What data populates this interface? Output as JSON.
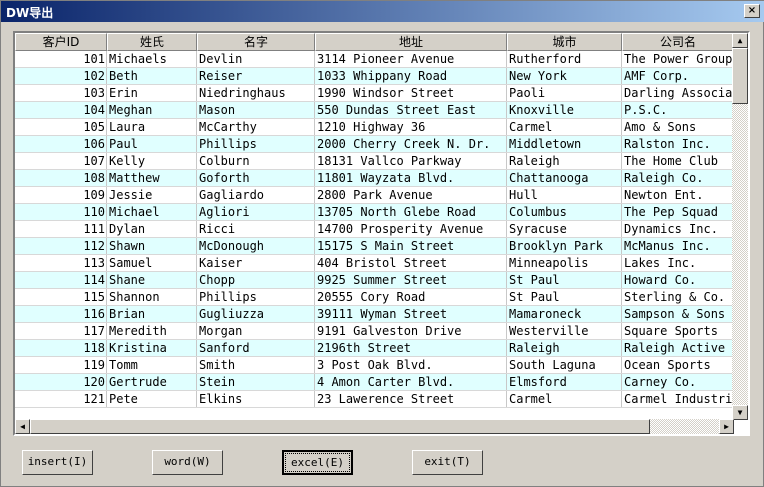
{
  "window": {
    "title": "DW导出",
    "close": "×"
  },
  "columns": [
    "客户ID",
    "姓氏",
    "名字",
    "地址",
    "城市",
    "公司名"
  ],
  "rows": [
    [
      "101",
      "Michaels",
      "Devlin",
      "3114 Pioneer Avenue",
      "Rutherford",
      "The Power Group"
    ],
    [
      "102",
      "Beth",
      "Reiser",
      "1033 Whippany Road",
      "New York",
      "AMF Corp."
    ],
    [
      "103",
      "Erin",
      "Niedringhaus",
      "1990 Windsor Street",
      "Paoli",
      "Darling Associates"
    ],
    [
      "104",
      "Meghan",
      "Mason",
      "550 Dundas Street East",
      "Knoxville",
      "P.S.C."
    ],
    [
      "105",
      "Laura",
      "McCarthy",
      "1210 Highway 36",
      "Carmel",
      "Amo & Sons"
    ],
    [
      "106",
      "Paul",
      "Phillips",
      "2000 Cherry Creek N. Dr.",
      "Middletown",
      "Ralston Inc."
    ],
    [
      "107",
      "Kelly",
      "Colburn",
      "18131 Vallco Parkway",
      "Raleigh",
      "The Home Club"
    ],
    [
      "108",
      "Matthew",
      "Goforth",
      "11801 Wayzata Blvd.",
      "Chattanooga",
      "Raleigh Co."
    ],
    [
      "109",
      "Jessie",
      "Gagliardo",
      "2800 Park Avenue",
      "Hull",
      "Newton Ent."
    ],
    [
      "110",
      "Michael",
      "Agliori",
      "13705 North Glebe Road",
      "Columbus",
      "The Pep Squad"
    ],
    [
      "111",
      "Dylan",
      "Ricci",
      "14700 Prosperity Avenue",
      "Syracuse",
      "Dynamics Inc."
    ],
    [
      "112",
      "Shawn",
      "McDonough",
      "15175 S Main Street",
      "Brooklyn Park",
      "McManus Inc."
    ],
    [
      "113",
      "Samuel",
      "Kaiser",
      "404 Bristol Street",
      "Minneapolis",
      "Lakes Inc."
    ],
    [
      "114",
      "Shane",
      "Chopp",
      "9925 Summer Street",
      "St Paul",
      "Howard Co."
    ],
    [
      "115",
      "Shannon",
      "Phillips",
      "20555 Cory Road",
      "St Paul",
      "Sterling & Co."
    ],
    [
      "116",
      "Brian",
      "Gugliuzza",
      "39111 Wyman Street",
      "Mamaroneck",
      "Sampson & Sons"
    ],
    [
      "117",
      "Meredith",
      "Morgan",
      "9191 Galveston Drive",
      "Westerville",
      "Square Sports"
    ],
    [
      "118",
      "Kristina",
      "Sanford",
      "2196th Street",
      "Raleigh",
      "Raleigh Active Wear"
    ],
    [
      "119",
      "Tomm",
      "Smith",
      "3 Post Oak Blvd.",
      "South Laguna",
      "Ocean Sports"
    ],
    [
      "120",
      "Gertrude",
      "Stein",
      "4 Amon Carter Blvd.",
      "Elmsford",
      "Carney Co."
    ],
    [
      "121",
      "Pete",
      "Elkins",
      "23 Lawerence Street",
      "Carmel",
      "Carmel Industries"
    ]
  ],
  "buttons": {
    "insert": "insert(I)",
    "word": "word(W)",
    "excel": "excel(E)",
    "exit": "exit(T)"
  },
  "colors": {
    "row_alt": "#e0ffff",
    "title_start": "#0a246a",
    "title_end": "#a6caf0"
  }
}
